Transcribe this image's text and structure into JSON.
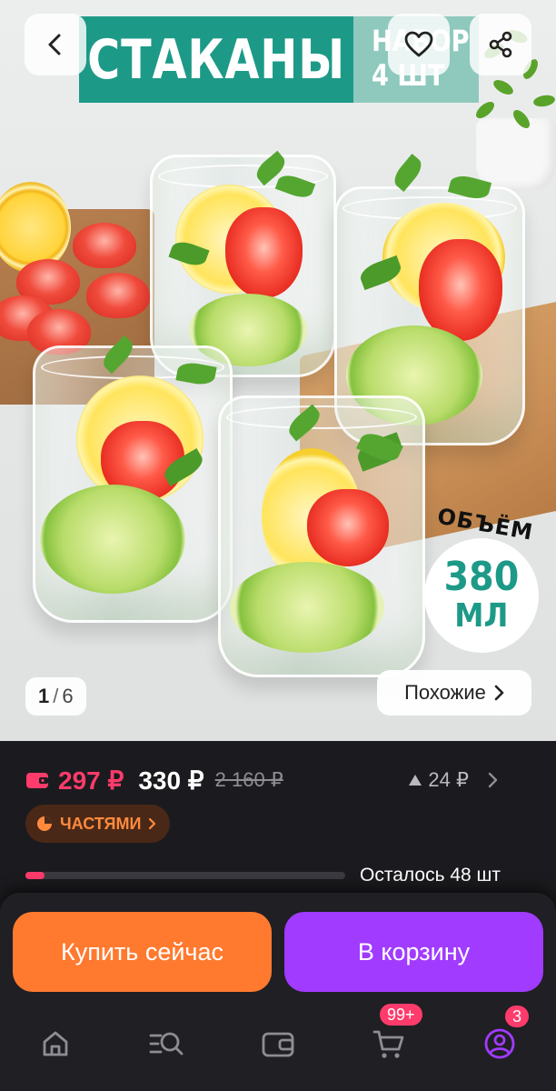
{
  "product_image": {
    "title_banner": "СТАКАНЫ",
    "set_banner_line1": "НАБОР",
    "set_banner_line2": "4 ШТ",
    "volume_label": "ОБЪЁМ",
    "volume_value": "380",
    "volume_unit": "МЛ",
    "pager_current": "1",
    "pager_separator": "/",
    "pager_total": "6",
    "similar_label": "Похожие"
  },
  "header_icons": {
    "back": "chevron-left-icon",
    "favorite": "heart-icon",
    "share": "share-icon"
  },
  "pricing": {
    "wallet_price": "297 ₽",
    "price": "330 ₽",
    "old_price": "2 160 ₽",
    "bonus": "24 ₽",
    "installments_label": "ЧАСТЯМИ"
  },
  "stock": {
    "remaining_text": "Осталось 48 шт",
    "progress_fraction": 0.06
  },
  "actions": {
    "buy_now_label": "Купить сейчас",
    "add_to_cart_label": "В корзину"
  },
  "tab_bar": {
    "cart_badge": "99+",
    "profile_badge": "3"
  },
  "colors": {
    "accent_pink": "#ff3b6b",
    "buy_orange": "#ff7a2f",
    "cart_purple": "#a13bff",
    "banner_teal": "#1d9a87",
    "installments_orange": "#ff8a3d"
  }
}
